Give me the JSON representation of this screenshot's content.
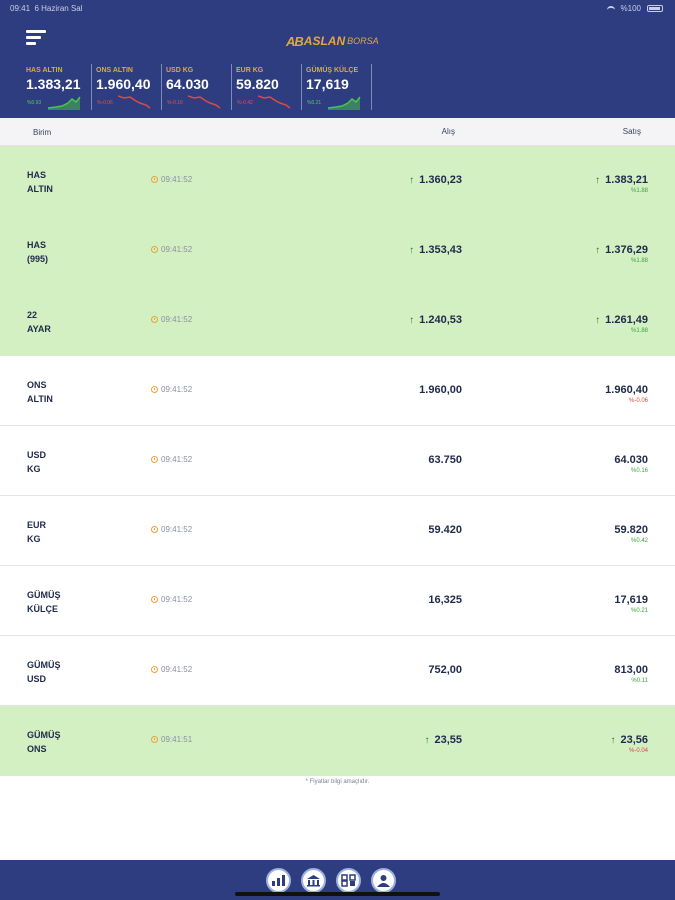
{
  "status": {
    "time": "09:41",
    "date": "6 Haziran Sal",
    "battery": "%100"
  },
  "header": {
    "logo_mark": "AB",
    "logo_text": "ASLAN",
    "logo_sub": "BORSA"
  },
  "tickers": [
    {
      "name": "HAS ALTIN",
      "value": "1.383,21",
      "pct": "%0.93",
      "trend": "up"
    },
    {
      "name": "ONS ALTIN",
      "value": "1.960,40",
      "pct": "%-0.06",
      "trend": "down"
    },
    {
      "name": "USD KG",
      "value": "64.030",
      "pct": "%-0.16",
      "trend": "down"
    },
    {
      "name": "EUR KG",
      "value": "59.820",
      "pct": "%-0.42",
      "trend": "down"
    },
    {
      "name": "GÜMÜŞ KÜLÇE",
      "value": "17,619",
      "pct": "%0.21",
      "trend": "up"
    }
  ],
  "table": {
    "col_birim": "Birim",
    "col_alis": "Alış",
    "col_satis": "Satış",
    "rows": [
      {
        "line1": "HAS",
        "line2": "ALTIN",
        "time": "09:41:52",
        "alis": "1.360,23",
        "satis": "1.383,21",
        "pct": "%1.88",
        "trend": "up",
        "highlight": true
      },
      {
        "line1": "HAS",
        "line2": "(995)",
        "time": "09:41:52",
        "alis": "1.353,43",
        "satis": "1.376,29",
        "pct": "%1.88",
        "trend": "up",
        "highlight": true
      },
      {
        "line1": "22",
        "line2": "AYAR",
        "time": "09:41:52",
        "alis": "1.240,53",
        "satis": "1.261,49",
        "pct": "%1.88",
        "trend": "up",
        "highlight": true
      },
      {
        "line1": "ONS",
        "line2": "ALTIN",
        "time": "09:41:52",
        "alis": "1.960,00",
        "satis": "1.960,40",
        "pct": "%-0.06",
        "trend": "down",
        "highlight": false
      },
      {
        "line1": "USD",
        "line2": "KG",
        "time": "09:41:52",
        "alis": "63.750",
        "satis": "64.030",
        "pct": "%0.16",
        "trend": "up",
        "highlight": false
      },
      {
        "line1": "EUR",
        "line2": "KG",
        "time": "09:41:52",
        "alis": "59.420",
        "satis": "59.820",
        "pct": "%0.42",
        "trend": "up",
        "highlight": false
      },
      {
        "line1": "GÜMÜŞ",
        "line2": "KÜLÇE",
        "time": "09:41:52",
        "alis": "16,325",
        "satis": "17,619",
        "pct": "%0.21",
        "trend": "up",
        "highlight": false
      },
      {
        "line1": "GÜMÜŞ",
        "line2": "USD",
        "time": "09:41:52",
        "alis": "752,00",
        "satis": "813,00",
        "pct": "%0.11",
        "trend": "up",
        "highlight": false
      },
      {
        "line1": "GÜMÜŞ",
        "line2": "ONS",
        "time": "09:41:51",
        "alis": "23,55",
        "satis": "23,56",
        "pct": "%-0.04",
        "trend": "down",
        "highlight": true
      }
    ]
  },
  "note": "* Fiyatlar bilgi amaçlıdır.",
  "nav": [
    {
      "icon": "chart-icon"
    },
    {
      "icon": "bank-icon"
    },
    {
      "icon": "converter-icon"
    },
    {
      "icon": "contact-icon"
    }
  ],
  "colors": {
    "primary": "#2d3d7f",
    "accent": "#e3a83a",
    "highlight_row": "#d3f0c3",
    "up": "#3aa23c",
    "down": "#d9423f"
  }
}
